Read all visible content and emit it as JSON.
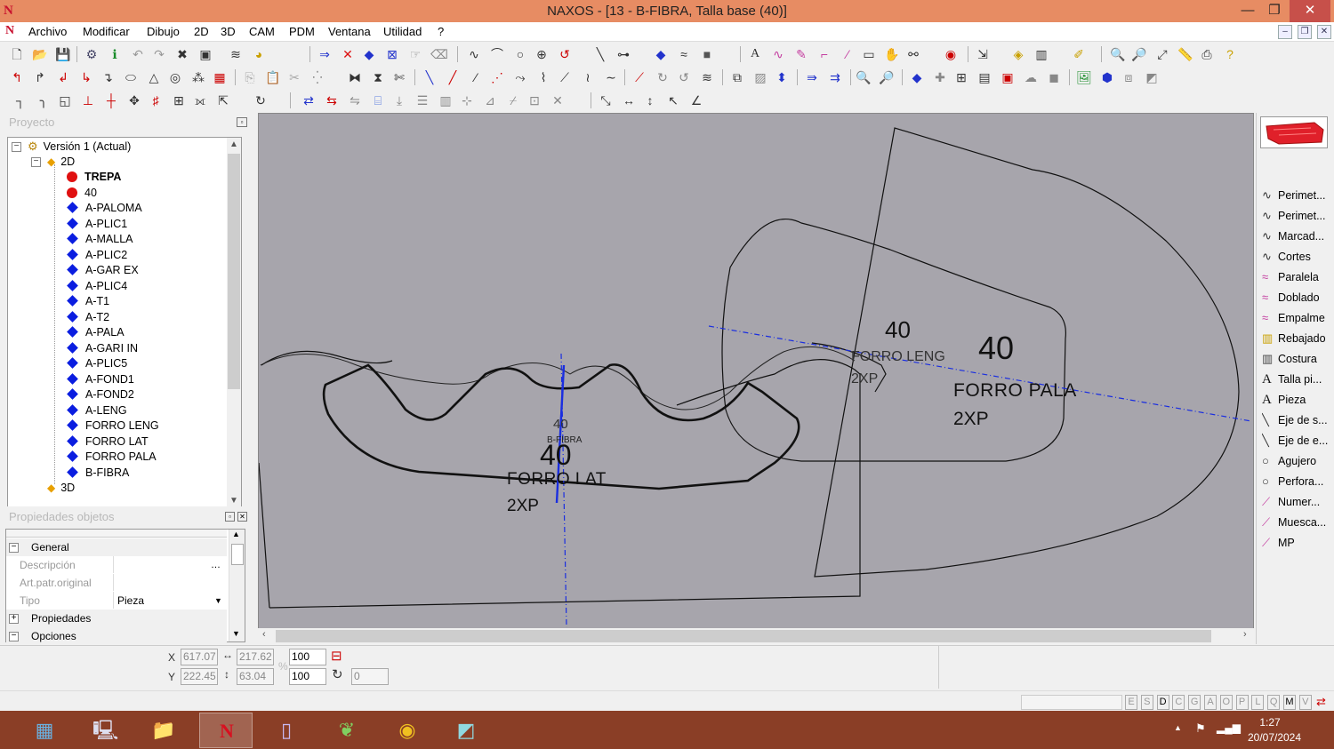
{
  "window": {
    "title": "NAXOS - [13 - B-FIBRA, Talla base (40)]",
    "minimize": "—",
    "restore": "❐",
    "close": "✕"
  },
  "menu": {
    "items": [
      "Archivo",
      "Modificar",
      "Dibujo",
      "2D",
      "3D",
      "CAM",
      "PDM",
      "Ventana",
      "Utilidad",
      "?"
    ]
  },
  "project": {
    "header": "Proyecto",
    "tree": [
      {
        "label": "Versión 1 (Actual)",
        "type": "version"
      },
      {
        "label": "2D",
        "type": "folder"
      },
      {
        "label": "TREPA",
        "type": "red",
        "bold": true
      },
      {
        "label": "40",
        "type": "red"
      },
      {
        "label": "A-PALOMA",
        "type": "piece"
      },
      {
        "label": "A-PLIC1",
        "type": "piece"
      },
      {
        "label": "A-MALLA",
        "type": "piece"
      },
      {
        "label": "A-PLIC2",
        "type": "piece"
      },
      {
        "label": "A-GAR EX",
        "type": "piece"
      },
      {
        "label": "A-PLIC4",
        "type": "piece"
      },
      {
        "label": "A-T1",
        "type": "piece"
      },
      {
        "label": "A-T2",
        "type": "piece"
      },
      {
        "label": "A-PALA",
        "type": "piece"
      },
      {
        "label": "A-GARI IN",
        "type": "piece"
      },
      {
        "label": "A-PLIC5",
        "type": "piece"
      },
      {
        "label": "A-FOND1",
        "type": "piece"
      },
      {
        "label": "A-FOND2",
        "type": "piece"
      },
      {
        "label": "A-LENG",
        "type": "piece"
      },
      {
        "label": "FORRO LENG",
        "type": "piece"
      },
      {
        "label": "FORRO LAT",
        "type": "piece"
      },
      {
        "label": "FORRO PALA",
        "type": "piece"
      },
      {
        "label": "B-FIBRA",
        "type": "piece"
      },
      {
        "label": "3D",
        "type": "folder"
      }
    ]
  },
  "properties": {
    "header": "Propiedades objetos",
    "sections": {
      "general": "General",
      "propiedades": "Propiedades",
      "opciones": "Opciones"
    },
    "rows": {
      "descripcion": {
        "label": "Descripción",
        "value": ""
      },
      "art_patr": {
        "label": "Art.patr.original",
        "value": ""
      },
      "tipo": {
        "label": "Tipo",
        "value": "Pieza"
      }
    }
  },
  "canvas": {
    "labels": {
      "forro_lat_size": "40",
      "forro_lat_name": "FORRO LAT",
      "forro_lat_qty": "2XP",
      "bfibra_size": "40",
      "bfibra_name": "B-FIBRA",
      "forro_leng_size": "40",
      "forro_leng_name": "FORRO LENG",
      "forro_leng_qty": "2XP",
      "forro_pala_size": "40",
      "forro_pala_name": "FORRO PALA",
      "forro_pala_qty": "2XP"
    },
    "colors": {
      "background": "#a7a5ac",
      "outline": "#111111",
      "axis": "#1a2ee0"
    }
  },
  "palette": {
    "items": [
      {
        "label": "Perimet...",
        "icon": "curve-icon"
      },
      {
        "label": "Perimet...",
        "icon": "curve-icon"
      },
      {
        "label": "Marcad...",
        "icon": "curve-icon"
      },
      {
        "label": "Cortes",
        "icon": "curve-icon"
      },
      {
        "label": "Paralela",
        "icon": "parallel-icon"
      },
      {
        "label": "Doblado",
        "icon": "fold-icon"
      },
      {
        "label": "Empalme",
        "icon": "join-icon"
      },
      {
        "label": "Rebajado",
        "icon": "skive-icon"
      },
      {
        "label": "Costura",
        "icon": "seam-icon"
      },
      {
        "label": "Talla pi...",
        "icon": "text-icon"
      },
      {
        "label": "Pieza",
        "icon": "text-icon"
      },
      {
        "label": "Eje de s...",
        "icon": "axis-icon"
      },
      {
        "label": "Eje de e...",
        "icon": "axis-icon"
      },
      {
        "label": "Agujero",
        "icon": "circle-icon"
      },
      {
        "label": "Perfora...",
        "icon": "circle-icon"
      },
      {
        "label": "Numer...",
        "icon": "pen-icon"
      },
      {
        "label": "Muesca...",
        "icon": "pen-icon"
      },
      {
        "label": "MP",
        "icon": "pen-icon"
      }
    ]
  },
  "status": {
    "x_label": "X",
    "y_label": "Y",
    "x": "617.07",
    "y": "222.45",
    "w": "217.62",
    "h": "63.04",
    "scale_x": "100",
    "scale_y": "100",
    "percent": "%",
    "rotation": "0",
    "modes": [
      "E",
      "S",
      "D",
      "C",
      "G",
      "A",
      "O",
      "P",
      "L",
      "Q",
      "M",
      "V"
    ]
  },
  "taskbar": {
    "time": "1:27",
    "date": "20/07/2024"
  }
}
